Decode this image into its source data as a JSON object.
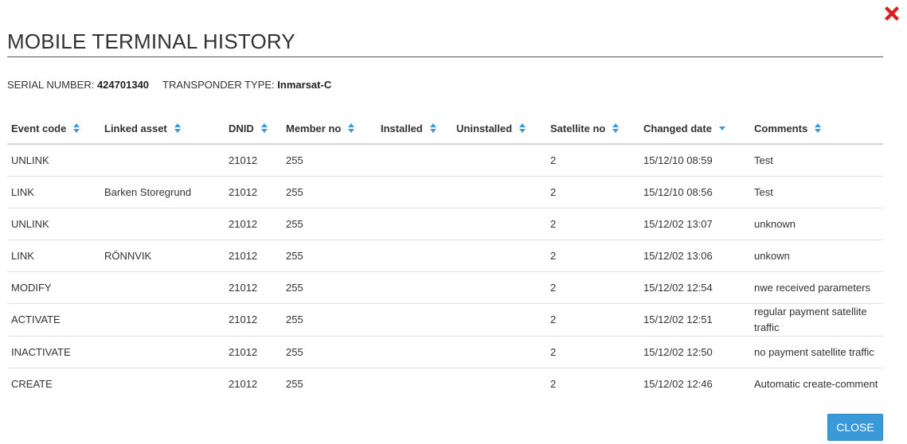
{
  "modal": {
    "title": "MOBILE TERMINAL HISTORY",
    "close_button_label": "CLOSE"
  },
  "info": {
    "serial_label": "SERIAL NUMBER:",
    "serial_value": "424701340",
    "transponder_label": "TRANSPONDER TYPE:",
    "transponder_value": "Inmarsat-C"
  },
  "table": {
    "columns": [
      {
        "label": "Event code",
        "sort": "both"
      },
      {
        "label": "Linked asset",
        "sort": "both"
      },
      {
        "label": "DNID",
        "sort": "both"
      },
      {
        "label": "Member no",
        "sort": "both"
      },
      {
        "label": "Installed",
        "sort": "both"
      },
      {
        "label": "Uninstalled",
        "sort": "both"
      },
      {
        "label": "Satellite no",
        "sort": "both"
      },
      {
        "label": "Changed date",
        "sort": "desc"
      },
      {
        "label": "Comments",
        "sort": "both"
      }
    ],
    "rows": [
      [
        "UNLINK",
        "",
        "21012",
        "255",
        "",
        "",
        "2",
        "15/12/10 08:59",
        "Test"
      ],
      [
        "LINK",
        "Barken Storegrund",
        "21012",
        "255",
        "",
        "",
        "2",
        "15/12/10 08:56",
        "Test"
      ],
      [
        "UNLINK",
        "",
        "21012",
        "255",
        "",
        "",
        "2",
        "15/12/02 13:07",
        "unknown"
      ],
      [
        "LINK",
        "RÖNNVIK",
        "21012",
        "255",
        "",
        "",
        "2",
        "15/12/02 13:06",
        "unkown"
      ],
      [
        "MODIFY",
        "",
        "21012",
        "255",
        "",
        "",
        "2",
        "15/12/02 12:54",
        "nwe received parameters"
      ],
      [
        "ACTIVATE",
        "",
        "21012",
        "255",
        "",
        "",
        "2",
        "15/12/02 12:51",
        "regular payment satellite traffic"
      ],
      [
        "INACTIVATE",
        "",
        "21012",
        "255",
        "",
        "",
        "2",
        "15/12/02 12:50",
        "no payment satellite traffic"
      ],
      [
        "CREATE",
        "",
        "21012",
        "255",
        "",
        "",
        "2",
        "15/12/02 12:46",
        "Automatic create-comment"
      ]
    ]
  },
  "colors": {
    "accent": "#3a9ad9",
    "close_icon": "#e01b1b",
    "sort_icon": "#3a9ad9"
  },
  "icons": {
    "close": "close-icon",
    "sort": "sort-icon"
  }
}
